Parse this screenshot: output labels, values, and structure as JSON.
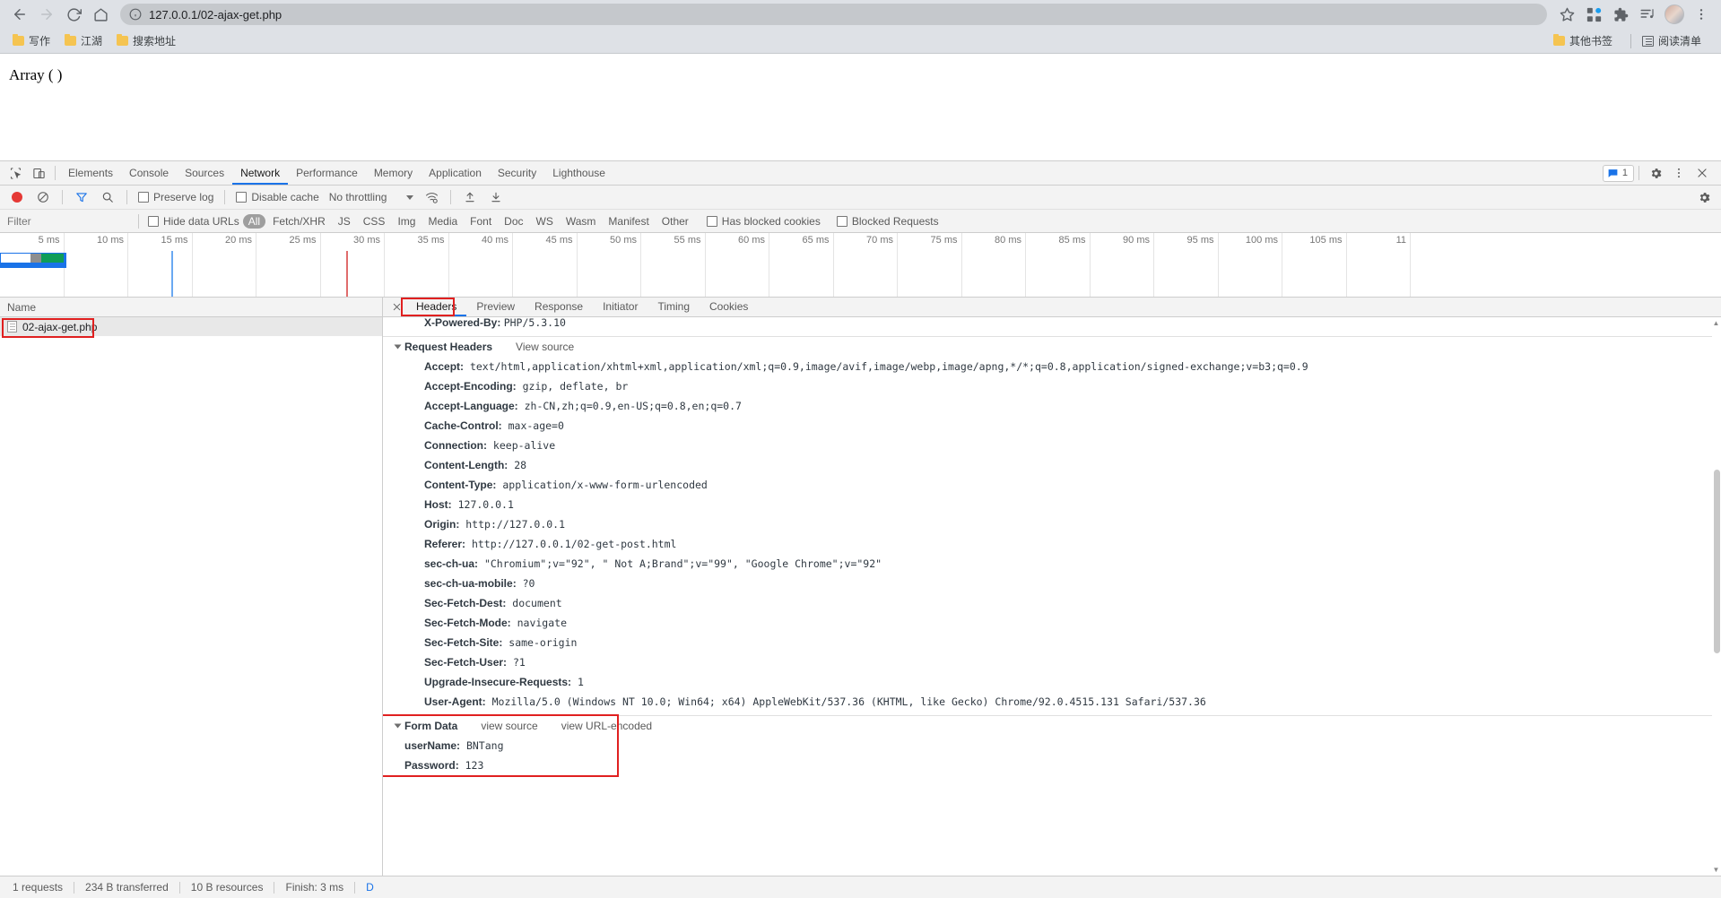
{
  "browser": {
    "url": "127.0.0.1/02-ajax-get.php",
    "back_label": "←",
    "forward_label": "→",
    "reload_label": "⟳",
    "home_label": "⌂",
    "bookmarks": [
      {
        "label": "写作"
      },
      {
        "label": "江湖"
      },
      {
        "label": "搜索地址"
      }
    ],
    "other_bookmarks": "其他书签",
    "reading_list": "阅读清单"
  },
  "page": {
    "output": "Array ( )"
  },
  "devtools": {
    "tabs": [
      {
        "label": "Elements",
        "active": false
      },
      {
        "label": "Console",
        "active": false
      },
      {
        "label": "Sources",
        "active": false
      },
      {
        "label": "Network",
        "active": true
      },
      {
        "label": "Performance",
        "active": false
      },
      {
        "label": "Memory",
        "active": false
      },
      {
        "label": "Application",
        "active": false
      },
      {
        "label": "Security",
        "active": false
      },
      {
        "label": "Lighthouse",
        "active": false
      }
    ],
    "message_count": "1"
  },
  "network_toolbar": {
    "preserve_log": "Preserve log",
    "disable_cache": "Disable cache",
    "throttling": "No throttling"
  },
  "filter_bar": {
    "filter_placeholder": "Filter",
    "hide_data_urls": "Hide data URLs",
    "resource_types": [
      {
        "label": "All",
        "selected": true
      },
      {
        "label": "Fetch/XHR",
        "selected": false
      },
      {
        "label": "JS",
        "selected": false
      },
      {
        "label": "CSS",
        "selected": false
      },
      {
        "label": "Img",
        "selected": false
      },
      {
        "label": "Media",
        "selected": false
      },
      {
        "label": "Font",
        "selected": false
      },
      {
        "label": "Doc",
        "selected": false
      },
      {
        "label": "WS",
        "selected": false
      },
      {
        "label": "Wasm",
        "selected": false
      },
      {
        "label": "Manifest",
        "selected": false
      },
      {
        "label": "Other",
        "selected": false
      }
    ],
    "has_blocked_cookies": "Has blocked cookies",
    "blocked_requests": "Blocked Requests"
  },
  "overview": {
    "ticks": [
      "5 ms",
      "10 ms",
      "15 ms",
      "20 ms",
      "25 ms",
      "30 ms",
      "35 ms",
      "40 ms",
      "45 ms",
      "50 ms",
      "55 ms",
      "60 ms",
      "65 ms",
      "70 ms",
      "75 ms",
      "80 ms",
      "85 ms",
      "90 ms",
      "95 ms",
      "100 ms",
      "105 ms",
      "11"
    ],
    "dom_content_loaded_color": "#6aa8f2",
    "load_color": "#e06c6c"
  },
  "request_list": {
    "column_header": "Name",
    "rows": [
      {
        "name": "02-ajax-get.php"
      }
    ]
  },
  "detail": {
    "tabs": [
      {
        "label": "Headers",
        "active": true
      },
      {
        "label": "Preview",
        "active": false
      },
      {
        "label": "Response",
        "active": false
      },
      {
        "label": "Initiator",
        "active": false
      },
      {
        "label": "Timing",
        "active": false
      },
      {
        "label": "Cookies",
        "active": false
      }
    ],
    "partial_top_header": {
      "name": "X-Powered-By:",
      "value": "PHP/5.3.10"
    },
    "request_headers": {
      "section_label": "Request Headers",
      "view_source": "View source",
      "items": [
        {
          "name": "Accept:",
          "value": "text/html,application/xhtml+xml,application/xml;q=0.9,image/avif,image/webp,image/apng,*/*;q=0.8,application/signed-exchange;v=b3;q=0.9"
        },
        {
          "name": "Accept-Encoding:",
          "value": "gzip, deflate, br"
        },
        {
          "name": "Accept-Language:",
          "value": "zh-CN,zh;q=0.9,en-US;q=0.8,en;q=0.7"
        },
        {
          "name": "Cache-Control:",
          "value": "max-age=0"
        },
        {
          "name": "Connection:",
          "value": "keep-alive"
        },
        {
          "name": "Content-Length:",
          "value": "28"
        },
        {
          "name": "Content-Type:",
          "value": "application/x-www-form-urlencoded"
        },
        {
          "name": "Host:",
          "value": "127.0.0.1"
        },
        {
          "name": "Origin:",
          "value": "http://127.0.0.1"
        },
        {
          "name": "Referer:",
          "value": "http://127.0.0.1/02-get-post.html"
        },
        {
          "name": "sec-ch-ua:",
          "value": "\"Chromium\";v=\"92\", \" Not A;Brand\";v=\"99\", \"Google Chrome\";v=\"92\""
        },
        {
          "name": "sec-ch-ua-mobile:",
          "value": "?0"
        },
        {
          "name": "Sec-Fetch-Dest:",
          "value": "document"
        },
        {
          "name": "Sec-Fetch-Mode:",
          "value": "navigate"
        },
        {
          "name": "Sec-Fetch-Site:",
          "value": "same-origin"
        },
        {
          "name": "Sec-Fetch-User:",
          "value": "?1"
        },
        {
          "name": "Upgrade-Insecure-Requests:",
          "value": "1"
        },
        {
          "name": "User-Agent:",
          "value": "Mozilla/5.0 (Windows NT 10.0; Win64; x64) AppleWebKit/537.36 (KHTML, like Gecko) Chrome/92.0.4515.131 Safari/537.36"
        }
      ]
    },
    "form_data": {
      "section_label": "Form Data",
      "view_source": "view source",
      "view_url_encoded": "view URL-encoded",
      "items": [
        {
          "name": "userName:",
          "value": "BNTang"
        },
        {
          "name": "Password:",
          "value": "123"
        }
      ]
    }
  },
  "status_bar": {
    "requests": "1 requests",
    "transferred": "234 B transferred",
    "resources": "10 B resources",
    "finish": "Finish: 3 ms",
    "dom_partial": "D"
  },
  "annotation_color": "#e02020"
}
